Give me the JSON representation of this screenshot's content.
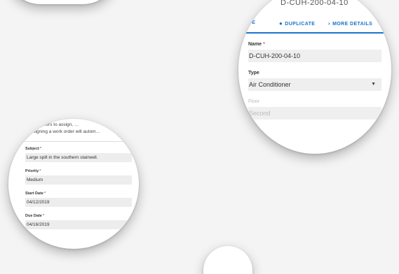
{
  "asset_form": {
    "top_text": "D-CUH-200-04-10",
    "toolbar": {
      "save_label": "SAVE",
      "duplicate_label": "DUPLICATE",
      "more_label": "MORE DETAILS"
    },
    "fields": [
      {
        "label": "Name",
        "required": "*",
        "value": "D-CUH-200-04-10"
      },
      {
        "label": "Type",
        "required": "",
        "value": "Air Conditioner"
      },
      {
        "label": "Floor",
        "required": "",
        "value": "Second"
      }
    ]
  },
  "work_order_form": {
    "intro_line1": "…work orders to assign, …",
    "intro_line2": "…assigning a work order will autom…",
    "fields": [
      {
        "label": "Subject",
        "required": "*",
        "value": "Large spill in the southern stairwell."
      },
      {
        "label": "Priority",
        "required": "*",
        "value": "Medium"
      },
      {
        "label": "Start Date",
        "required": "*",
        "value": "04/12/2019"
      },
      {
        "label": "Due Date",
        "required": "*",
        "value": "04/16/2019"
      }
    ]
  },
  "icons": {
    "duplicate": "location-pin-icon",
    "more": "chevron-right-icon",
    "select": "dropdown-caret-icon"
  }
}
